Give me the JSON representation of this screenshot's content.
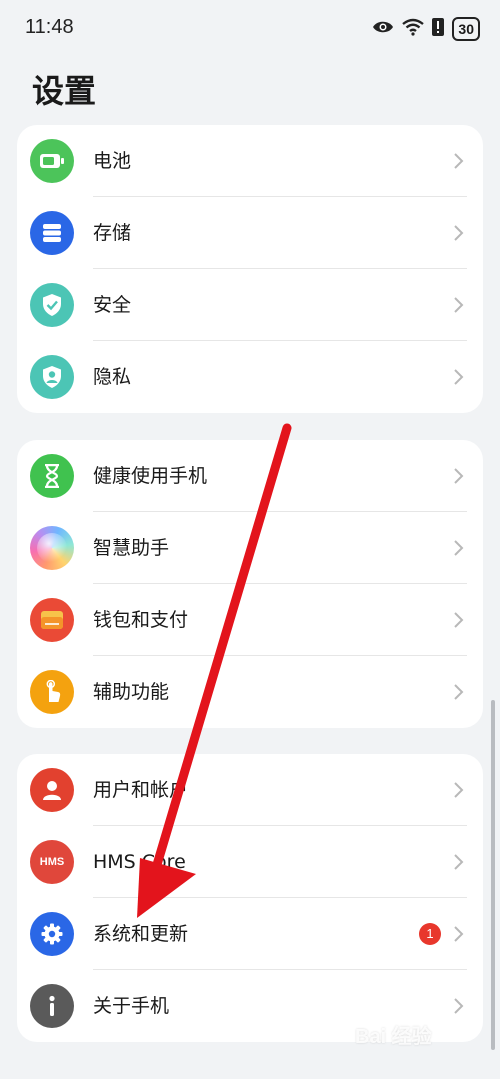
{
  "status_bar": {
    "time": "11:48",
    "battery_level": "30",
    "icons": [
      "eye-icon",
      "wifi-icon",
      "alert-icon",
      "battery-icon"
    ]
  },
  "page": {
    "title": "设置"
  },
  "groups": [
    {
      "items": [
        {
          "label": "电池",
          "icon": "battery-icon",
          "color": "#4cc45a"
        },
        {
          "label": "存储",
          "icon": "storage-icon",
          "color": "#2a67e6"
        },
        {
          "label": "安全",
          "icon": "shield-icon",
          "color": "#4cc5b5"
        },
        {
          "label": "隐私",
          "icon": "privacy-icon",
          "color": "#4cc5b5"
        }
      ]
    },
    {
      "items": [
        {
          "label": "健康使用手机",
          "icon": "hourglass-icon",
          "color": "#40c24f"
        },
        {
          "label": "智慧助手",
          "icon": "assistant-icon",
          "color": "#b98df0"
        },
        {
          "label": "钱包和支付",
          "icon": "wallet-icon",
          "color": "#ea4a36"
        },
        {
          "label": "辅助功能",
          "icon": "hand-pointer-icon",
          "color": "#f4a20f"
        }
      ]
    },
    {
      "items": [
        {
          "label": "用户和帐户",
          "icon": "user-icon",
          "color": "#e2412f"
        },
        {
          "label": "HMS Core",
          "icon": "hms-core-icon",
          "icon_text": "HMS",
          "color": "#e0473b"
        },
        {
          "label": "系统和更新",
          "icon": "gear-icon",
          "color": "#2a67e6",
          "badge": "1"
        },
        {
          "label": "关于手机",
          "icon": "info-icon",
          "color": "#5a5a5a"
        }
      ]
    }
  ],
  "watermark": "Bai 经验"
}
